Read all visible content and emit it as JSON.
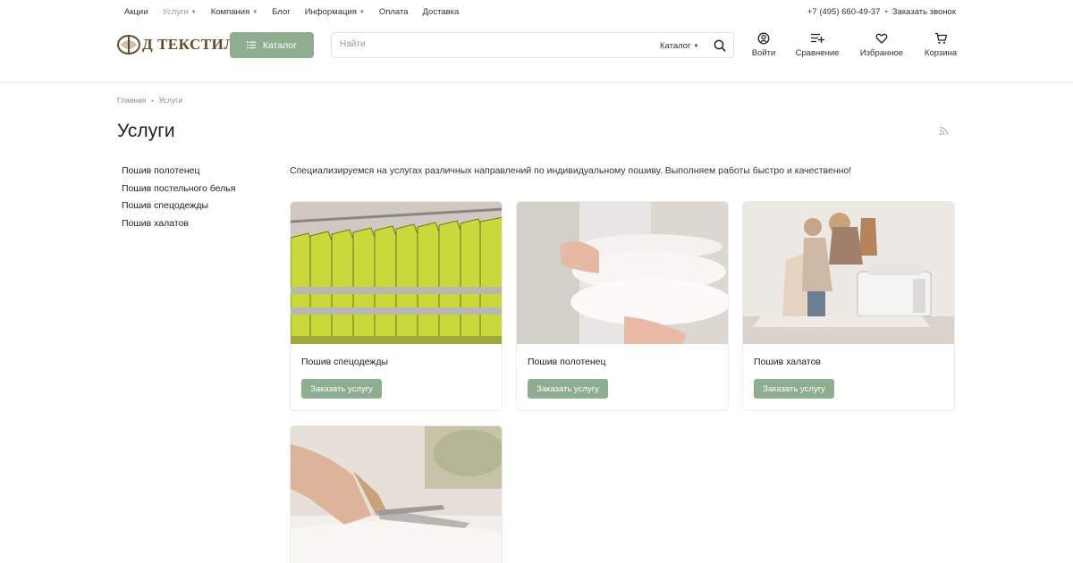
{
  "topnav": {
    "items": [
      {
        "label": "Акции"
      },
      {
        "label": "Услуги"
      },
      {
        "label": "Компания"
      },
      {
        "label": "Блог"
      },
      {
        "label": "Информация"
      },
      {
        "label": "Оплата"
      },
      {
        "label": "Доставка"
      }
    ],
    "phone": "+7 (495) 660-49-37",
    "callback": "Заказать звонок"
  },
  "header": {
    "logo_text": "Д ТЕКСТИЛЬ",
    "catalog_label": "Каталог",
    "search": {
      "placeholder": "Найти",
      "scope": "Каталог"
    },
    "icons": [
      {
        "label": "Войти",
        "icon": "user-icon"
      },
      {
        "label": "Сравнение",
        "icon": "compare-icon"
      },
      {
        "label": "Избранное",
        "icon": "heart-icon"
      },
      {
        "label": "Корзина",
        "icon": "cart-icon"
      }
    ]
  },
  "breadcrumb": {
    "home": "Главная",
    "current": "Услуги"
  },
  "page": {
    "title": "Услуги",
    "intro": "Специализируемся на услугах различных направлений по индивидуальному пошиву. Выполняем работы быстро и качественно!"
  },
  "sidebar": {
    "items": [
      {
        "label": "Пошив полотенец"
      },
      {
        "label": "Пошив постельного белья"
      },
      {
        "label": "Пошив спецодежды"
      },
      {
        "label": "Пошив халатов"
      }
    ]
  },
  "services": [
    {
      "name": "Пошив спецодежды",
      "button": "Заказать услугу"
    },
    {
      "name": "Пошив полотенец",
      "button": "Заказать услугу"
    },
    {
      "name": "Пошив халатов",
      "button": "Заказать услугу"
    },
    {
      "name": "",
      "button": ""
    }
  ],
  "colors": {
    "accent": "#8fae91",
    "active_nav": "#8fa88f",
    "logo": "#6b4a2a"
  }
}
